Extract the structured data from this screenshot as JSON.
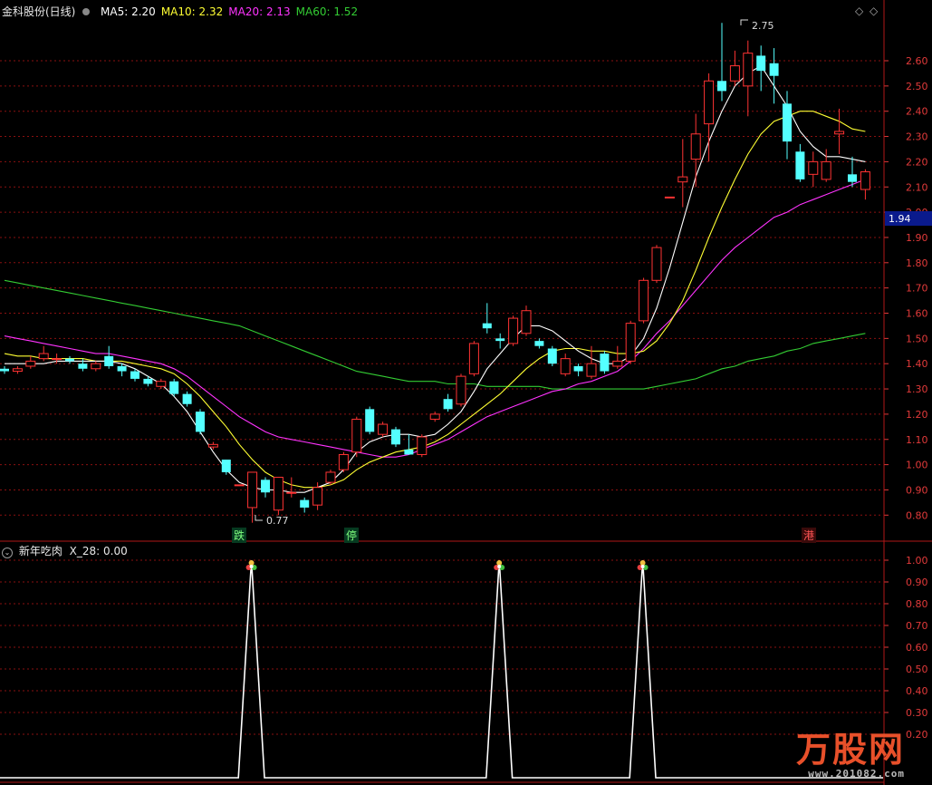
{
  "header": {
    "title": "金科股份(日线)",
    "ma": [
      {
        "label": "MA5:",
        "value": "2.20",
        "color": "#ffffff"
      },
      {
        "label": "MA10:",
        "value": "2.32",
        "color": "#ffff33"
      },
      {
        "label": "MA20:",
        "value": "2.13",
        "color": "#ff33ff"
      },
      {
        "label": "MA60:",
        "value": "1.52",
        "color": "#33cc33"
      }
    ],
    "sub_title": "新年吃肉",
    "sub_label": "X_28:",
    "sub_value": "0.00",
    "current_price": "1.94"
  },
  "markers": {
    "die": "跌",
    "ting": "停",
    "gang": "港"
  },
  "annotations": {
    "high": "2.75",
    "low": "0.77"
  },
  "watermark": {
    "brand": "万股网",
    "url": "www.201082.com"
  },
  "colors": {
    "up": "#ff3333",
    "down": "#54ffff",
    "ma5": "#ffffff",
    "ma10": "#ffff33",
    "ma20": "#ff33ff",
    "ma60": "#33cc33",
    "axis": "#e23a3a",
    "grid": "#8a1010"
  },
  "chart_data": [
    {
      "type": "candlestick",
      "title": "金科股份(日线)",
      "ylim": [
        0.75,
        2.7
      ],
      "yticks": [
        0.8,
        0.9,
        1.0,
        1.1,
        1.2,
        1.3,
        1.4,
        1.5,
        1.6,
        1.7,
        1.8,
        1.9,
        2.0,
        2.1,
        2.2,
        2.3,
        2.4,
        2.5,
        2.6
      ],
      "candles": [
        [
          1.38,
          1.37,
          1.39,
          1.36
        ],
        [
          1.37,
          1.38,
          1.39,
          1.36
        ],
        [
          1.39,
          1.41,
          1.43,
          1.38
        ],
        [
          1.42,
          1.44,
          1.47,
          1.41
        ],
        [
          1.42,
          1.42,
          1.44,
          1.4
        ],
        [
          1.42,
          1.41,
          1.43,
          1.4
        ],
        [
          1.4,
          1.38,
          1.42,
          1.37
        ],
        [
          1.38,
          1.4,
          1.41,
          1.37
        ],
        [
          1.43,
          1.39,
          1.47,
          1.38
        ],
        [
          1.39,
          1.37,
          1.4,
          1.35
        ],
        [
          1.37,
          1.34,
          1.38,
          1.33
        ],
        [
          1.34,
          1.32,
          1.35,
          1.31
        ],
        [
          1.31,
          1.33,
          1.34,
          1.3
        ],
        [
          1.33,
          1.28,
          1.34,
          1.27
        ],
        [
          1.28,
          1.24,
          1.29,
          1.23
        ],
        [
          1.21,
          1.13,
          1.22,
          1.12
        ],
        [
          1.07,
          1.08,
          1.09,
          1.06
        ],
        [
          1.02,
          0.97,
          1.02,
          0.96
        ],
        [
          0.92,
          0.92,
          0.92,
          0.92
        ],
        [
          0.83,
          0.97,
          0.97,
          0.77
        ],
        [
          0.94,
          0.89,
          0.95,
          0.87
        ],
        [
          0.82,
          0.95,
          0.95,
          0.8
        ],
        [
          0.89,
          0.89,
          0.95,
          0.87
        ],
        [
          0.86,
          0.83,
          0.87,
          0.81
        ],
        [
          0.84,
          0.91,
          0.93,
          0.82
        ],
        [
          0.93,
          0.97,
          0.98,
          0.92
        ],
        [
          0.98,
          1.04,
          1.05,
          0.97
        ],
        [
          1.05,
          1.18,
          1.19,
          1.03
        ],
        [
          1.22,
          1.13,
          1.23,
          1.12
        ],
        [
          1.12,
          1.16,
          1.17,
          1.11
        ],
        [
          1.14,
          1.08,
          1.15,
          1.07
        ],
        [
          1.06,
          1.04,
          1.12,
          1.04
        ],
        [
          1.04,
          1.11,
          1.12,
          1.03
        ],
        [
          1.18,
          1.2,
          1.21,
          1.17
        ],
        [
          1.26,
          1.22,
          1.28,
          1.21
        ],
        [
          1.24,
          1.35,
          1.36,
          1.23
        ],
        [
          1.36,
          1.48,
          1.49,
          1.35
        ],
        [
          1.56,
          1.54,
          1.64,
          1.52
        ],
        [
          1.5,
          1.49,
          1.52,
          1.46
        ],
        [
          1.48,
          1.58,
          1.59,
          1.47
        ],
        [
          1.52,
          1.61,
          1.63,
          1.51
        ],
        [
          1.49,
          1.47,
          1.5,
          1.46
        ],
        [
          1.46,
          1.4,
          1.47,
          1.39
        ],
        [
          1.36,
          1.42,
          1.44,
          1.35
        ],
        [
          1.39,
          1.37,
          1.4,
          1.35
        ],
        [
          1.35,
          1.4,
          1.47,
          1.34
        ],
        [
          1.44,
          1.37,
          1.45,
          1.36
        ],
        [
          1.39,
          1.41,
          1.47,
          1.38
        ],
        [
          1.41,
          1.56,
          1.57,
          1.4
        ],
        [
          1.57,
          1.73,
          1.74,
          1.56
        ],
        [
          1.73,
          1.86,
          1.87,
          1.72
        ],
        [
          2.06,
          2.06,
          2.06,
          2.06
        ],
        [
          2.12,
          2.14,
          2.29,
          2.02
        ],
        [
          2.21,
          2.31,
          2.39,
          2.1
        ],
        [
          2.35,
          2.52,
          2.55,
          2.2
        ],
        [
          2.52,
          2.48,
          2.75,
          2.44
        ],
        [
          2.52,
          2.58,
          2.64,
          2.5
        ],
        [
          2.5,
          2.63,
          2.68,
          2.38
        ],
        [
          2.62,
          2.56,
          2.66,
          2.48
        ],
        [
          2.59,
          2.54,
          2.65,
          2.43
        ],
        [
          2.43,
          2.28,
          2.48,
          2.21
        ],
        [
          2.24,
          2.13,
          2.27,
          2.12
        ],
        [
          2.15,
          2.2,
          2.24,
          2.1
        ],
        [
          2.13,
          2.2,
          2.25,
          2.12
        ],
        [
          2.31,
          2.32,
          2.41,
          2.23
        ],
        [
          2.15,
          2.12,
          2.22,
          2.1
        ],
        [
          2.09,
          2.16,
          2.17,
          2.05
        ]
      ],
      "ma5": [
        1.4,
        1.4,
        1.4,
        1.4,
        1.41,
        1.41,
        1.41,
        1.41,
        1.41,
        1.4,
        1.38,
        1.35,
        1.32,
        1.27,
        1.21,
        1.13,
        1.05,
        0.98,
        0.93,
        0.91,
        0.9,
        0.9,
        0.89,
        0.89,
        0.91,
        0.93,
        0.98,
        1.05,
        1.09,
        1.11,
        1.12,
        1.12,
        1.11,
        1.12,
        1.16,
        1.21,
        1.29,
        1.38,
        1.44,
        1.5,
        1.55,
        1.55,
        1.53,
        1.49,
        1.45,
        1.42,
        1.4,
        1.4,
        1.43,
        1.5,
        1.62,
        1.78,
        1.96,
        2.14,
        2.28,
        2.4,
        2.5,
        2.55,
        2.58,
        2.5,
        2.42,
        2.32,
        2.26,
        2.22,
        2.22,
        2.21,
        2.2
      ],
      "ma10": [
        1.44,
        1.43,
        1.43,
        1.42,
        1.42,
        1.42,
        1.42,
        1.41,
        1.41,
        1.41,
        1.4,
        1.39,
        1.38,
        1.36,
        1.32,
        1.27,
        1.21,
        1.15,
        1.08,
        1.02,
        0.97,
        0.94,
        0.92,
        0.91,
        0.91,
        0.92,
        0.94,
        0.98,
        1.01,
        1.03,
        1.05,
        1.06,
        1.07,
        1.09,
        1.12,
        1.16,
        1.2,
        1.24,
        1.28,
        1.33,
        1.38,
        1.42,
        1.45,
        1.46,
        1.46,
        1.45,
        1.45,
        1.44,
        1.44,
        1.45,
        1.49,
        1.56,
        1.65,
        1.77,
        1.9,
        2.02,
        2.13,
        2.23,
        2.31,
        2.36,
        2.38,
        2.4,
        2.4,
        2.38,
        2.36,
        2.33,
        2.32
      ],
      "ma20": [
        1.51,
        1.5,
        1.49,
        1.48,
        1.47,
        1.46,
        1.45,
        1.44,
        1.44,
        1.43,
        1.42,
        1.41,
        1.4,
        1.38,
        1.35,
        1.31,
        1.27,
        1.23,
        1.19,
        1.16,
        1.13,
        1.11,
        1.1,
        1.09,
        1.08,
        1.07,
        1.06,
        1.05,
        1.04,
        1.03,
        1.03,
        1.04,
        1.06,
        1.08,
        1.1,
        1.13,
        1.16,
        1.19,
        1.21,
        1.23,
        1.25,
        1.27,
        1.29,
        1.3,
        1.32,
        1.33,
        1.35,
        1.37,
        1.41,
        1.46,
        1.52,
        1.57,
        1.63,
        1.69,
        1.75,
        1.81,
        1.86,
        1.9,
        1.94,
        1.98,
        2.0,
        2.03,
        2.05,
        2.07,
        2.09,
        2.11,
        2.13
      ],
      "ma60": [
        1.73,
        1.72,
        1.71,
        1.7,
        1.69,
        1.68,
        1.67,
        1.66,
        1.65,
        1.64,
        1.63,
        1.62,
        1.61,
        1.6,
        1.59,
        1.58,
        1.57,
        1.56,
        1.55,
        1.53,
        1.51,
        1.49,
        1.47,
        1.45,
        1.43,
        1.41,
        1.39,
        1.37,
        1.36,
        1.35,
        1.34,
        1.33,
        1.33,
        1.33,
        1.32,
        1.32,
        1.32,
        1.31,
        1.31,
        1.31,
        1.31,
        1.31,
        1.3,
        1.3,
        1.3,
        1.3,
        1.3,
        1.3,
        1.3,
        1.3,
        1.31,
        1.32,
        1.33,
        1.34,
        1.36,
        1.38,
        1.39,
        1.41,
        1.42,
        1.43,
        1.45,
        1.46,
        1.48,
        1.49,
        1.5,
        1.51,
        1.52
      ]
    },
    {
      "type": "line",
      "title": "新年吃肉",
      "ylim": [
        0.0,
        1.05
      ],
      "yticks": [
        0.2,
        0.3,
        0.4,
        0.5,
        0.6,
        0.7,
        0.8,
        0.9,
        1.0
      ],
      "signal_peaks": [
        19,
        38,
        49
      ],
      "values": [
        0,
        0,
        0,
        0,
        0,
        0,
        0,
        0,
        0,
        0,
        0,
        0,
        0,
        0,
        0,
        0,
        0,
        0,
        0,
        1,
        0,
        0,
        0,
        0,
        0,
        0,
        0,
        0,
        0,
        0,
        0,
        0,
        0,
        0,
        0,
        0,
        0,
        0,
        1,
        0,
        0,
        0,
        0,
        0,
        0,
        0,
        0,
        0,
        0,
        1,
        0,
        0,
        0,
        0,
        0,
        0,
        0,
        0,
        0,
        0,
        0,
        0,
        0,
        0,
        0,
        0,
        0
      ]
    }
  ]
}
